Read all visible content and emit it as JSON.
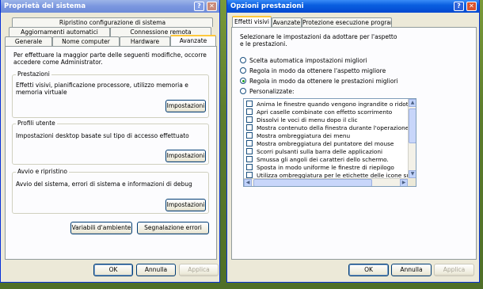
{
  "left_window": {
    "title": "Proprietà del sistema",
    "help_glyph": "?",
    "close_glyph": "✕",
    "tabs": {
      "row1": [
        "Ripristino configurazione di sistema"
      ],
      "row2": [
        "Aggiornamenti automatici",
        "Connessione remota"
      ],
      "row3": [
        "Generale",
        "Nome computer",
        "Hardware",
        "Avanzate"
      ]
    },
    "selected_tab": "Avanzate",
    "intro": "Per effettuare la maggior parte delle seguenti modifiche, occorre accedere come Administrator.",
    "groups": [
      {
        "title": "Prestazioni",
        "text": "Effetti visivi, pianificazione processore, utilizzo memoria e memoria virtuale",
        "button": "Impostazioni"
      },
      {
        "title": "Profili utente",
        "text": "Impostazioni desktop basate sul tipo di accesso effettuato",
        "button": "Impostazioni"
      },
      {
        "title": "Avvio e ripristino",
        "text": "Avvio del sistema, errori di sistema e informazioni di debug",
        "button": "Impostazioni"
      }
    ],
    "env_button": "Variabili d'ambiente",
    "errors_button": "Segnalazione errori",
    "ok": "OK",
    "cancel": "Annulla",
    "apply": "Applica"
  },
  "right_window": {
    "title": "Opzioni prestazioni",
    "help_glyph": "?",
    "close_glyph": "✕",
    "tabs": [
      "Effetti visivi",
      "Avanzate",
      "Protezione esecuzione programmi"
    ],
    "selected_tab": "Effetti visivi",
    "intro": "Selezionare le impostazioni da adottare per l'aspetto e le prestazioni.",
    "radios": [
      {
        "label": "Scelta automatica impostazioni migliori",
        "checked": false
      },
      {
        "label": "Regola in modo da ottenere l'aspetto migliore",
        "checked": false
      },
      {
        "label": "Regola in modo da ottenere le prestazioni migliori",
        "checked": true
      },
      {
        "label": "Personalizzate:",
        "checked": false
      }
    ],
    "effects": [
      "Anima le finestre quando vengono ingrandite o ridotte ad",
      "Apri caselle combinate con effetto scorrimento",
      "Dissolvi le voci di menu dopo il clic",
      "Mostra contenuto della finestra durante l'operazione di tra",
      "Mostra ombreggiatura dei menu",
      "Mostra ombreggiatura del puntatore del mouse",
      "Scorri pulsanti sulla barra delle applicazioni",
      "Smussa gli angoli dei caratteri dello schermo.",
      "Sposta in modo uniforme le finestre di riepilogo",
      "Utilizza ombreggiatura per le etichette delle icone sul desk"
    ],
    "arrows": {
      "up": "▲",
      "down": "▼",
      "left": "◀",
      "right": "▶"
    },
    "ok": "OK",
    "cancel": "Annulla",
    "apply": "Applica"
  }
}
